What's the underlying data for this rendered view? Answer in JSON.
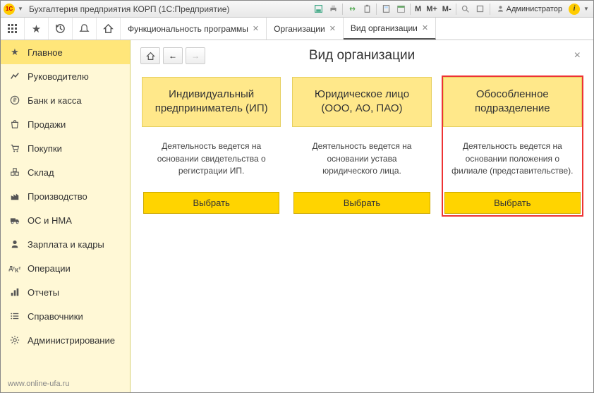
{
  "top": {
    "title": "Бухгалтерия предприятия КОРП  (1С:Предприятие)",
    "m": "M",
    "mplus": "M+",
    "mminus": "M-",
    "user_label": "Администратор"
  },
  "tabs": [
    {
      "label": "Функциональность программы",
      "active": false
    },
    {
      "label": "Организации",
      "active": false
    },
    {
      "label": "Вид организации",
      "active": true
    }
  ],
  "sidebar": {
    "items": [
      {
        "label": "Главное",
        "icon": "star"
      },
      {
        "label": "Руководителю",
        "icon": "chart"
      },
      {
        "label": "Банк и касса",
        "icon": "ruble"
      },
      {
        "label": "Продажи",
        "icon": "bag"
      },
      {
        "label": "Покупки",
        "icon": "cart"
      },
      {
        "label": "Склад",
        "icon": "boxes"
      },
      {
        "label": "Производство",
        "icon": "factory"
      },
      {
        "label": "ОС и НМА",
        "icon": "truck"
      },
      {
        "label": "Зарплата и кадры",
        "icon": "person"
      },
      {
        "label": "Операции",
        "icon": "dk"
      },
      {
        "label": "Отчеты",
        "icon": "bars"
      },
      {
        "label": "Справочники",
        "icon": "list"
      },
      {
        "label": "Администрирование",
        "icon": "gear"
      }
    ],
    "footer": "www.online-ufa.ru"
  },
  "page": {
    "title": "Вид организации",
    "cards": [
      {
        "head": "Индивидуальный предприниматель (ИП)",
        "desc": "Деятельность ведется на основании свидетельства о регистрации ИП.",
        "btn": "Выбрать"
      },
      {
        "head": "Юридическое лицо (ООО, АО, ПАО)",
        "desc": "Деятельность ведется на основании устава юридического лица.",
        "btn": "Выбрать"
      },
      {
        "head": "Обособленное подразделение",
        "desc": "Деятельность ведется на основании положения о филиале (представительстве).",
        "btn": "Выбрать"
      }
    ]
  }
}
